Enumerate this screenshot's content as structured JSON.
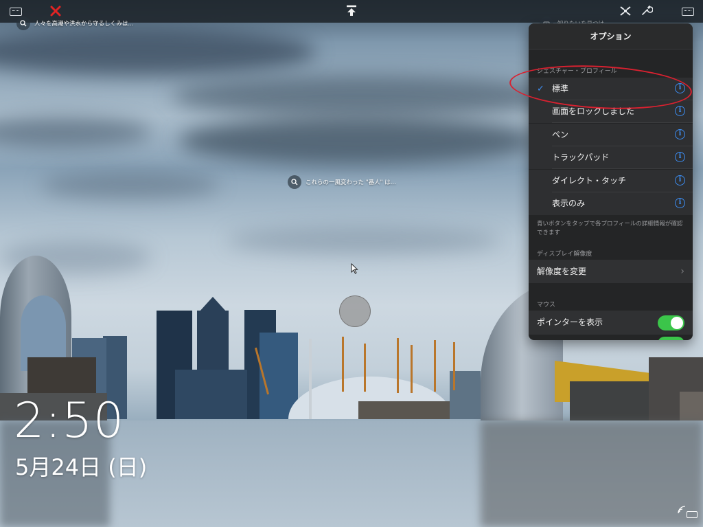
{
  "topbar": {
    "left_keyboard_icon": "keyboard-icon",
    "close_icon": "close-icon",
    "close_color": "#e02424",
    "upload_icon": "upload-icon",
    "fullscreen_icon": "fullscreen-icon",
    "settings_icon": "wrench-icon",
    "right_keyboard_icon": "keyboard-icon"
  },
  "desktop": {
    "search_top_left": "人々を高潮や洪水から守るしくみは...",
    "search_top_right": "知りたいを見つけ...",
    "search_center": "これらの一風変わった \"番人\" は...",
    "touch_indicator": "touch-pointer",
    "clock": "2:50",
    "date": "5月24日 (日)"
  },
  "options_panel": {
    "title": "オプション",
    "gesture_section_header": "ジェスチャー・プロフィール",
    "profiles": [
      {
        "label": "標準",
        "selected": true
      },
      {
        "label": "画面をロックしました",
        "selected": false
      },
      {
        "label": "ペン",
        "selected": false
      },
      {
        "label": "トラックパッド",
        "selected": false
      },
      {
        "label": "ダイレクト・タッチ",
        "selected": false
      },
      {
        "label": "表示のみ",
        "selected": false
      }
    ],
    "check_mark": "✓",
    "info_glyph": "i",
    "profile_note": "青いボタンをタップで各プロフィールの詳細情報が確認できます",
    "display_section_header": "ディスプレイ解像度",
    "resolution_label": "解像度を変更",
    "resolution_chevron": "›",
    "mouse_section_header": "マウス",
    "show_pointer_label": "ポインターを表示",
    "show_pointer_on": true,
    "accent_color": "#3c8cf0",
    "toggle_color": "#3bc54a"
  },
  "annotation": {
    "color": "#d92130"
  }
}
